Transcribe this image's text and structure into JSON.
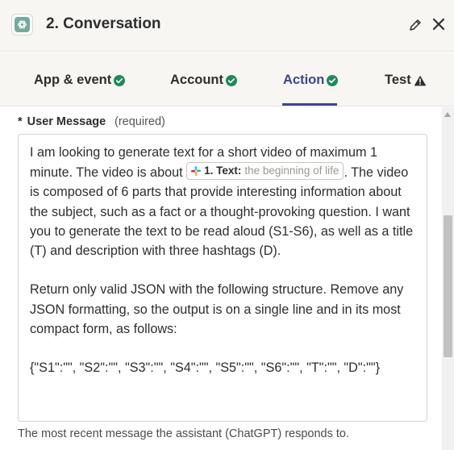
{
  "header": {
    "title": "2. Conversation",
    "app_icon": "openai-icon",
    "edit_icon": "pencil-icon",
    "close_icon": "close-icon"
  },
  "tabs": [
    {
      "label": "App & event",
      "status": "complete"
    },
    {
      "label": "Account",
      "status": "complete"
    },
    {
      "label": "Action",
      "status": "complete",
      "active": true
    },
    {
      "label": "Test",
      "status": "warning"
    }
  ],
  "field": {
    "required_marker": "*",
    "label": "User Message",
    "required_text": "(required)",
    "text_line1": "I am looking to generate text for a short video of maximum 1 minute. The video is about ",
    "pill_label": "1. Text:",
    "pill_value": "the beginning of life",
    "text_line2": ". The video is composed of 6 parts that provide interesting information about the subject, such as a fact or a thought-provoking question. I want you to generate the text to be read aloud (S1-S6), as well as a title (T) and description with three hashtags (D).",
    "text_para2": "Return only valid JSON with the following structure. Remove any JSON formatting, so the output is on a single line and in its most compact form, as follows:",
    "text_para3": "{\"S1\":\"\", \"S2\":\"\", \"S3\":\"\", \"S4\":\"\", \"S5\":\"\", \"S6\":\"\", \"T\":\"\", \"D\":\"\"}",
    "help_text": "The most recent message the assistant (ChatGPT) responds to."
  },
  "colors": {
    "accent": "#3d4592",
    "success": "#1f8a5b",
    "header_bg": "#f7f6f2"
  }
}
